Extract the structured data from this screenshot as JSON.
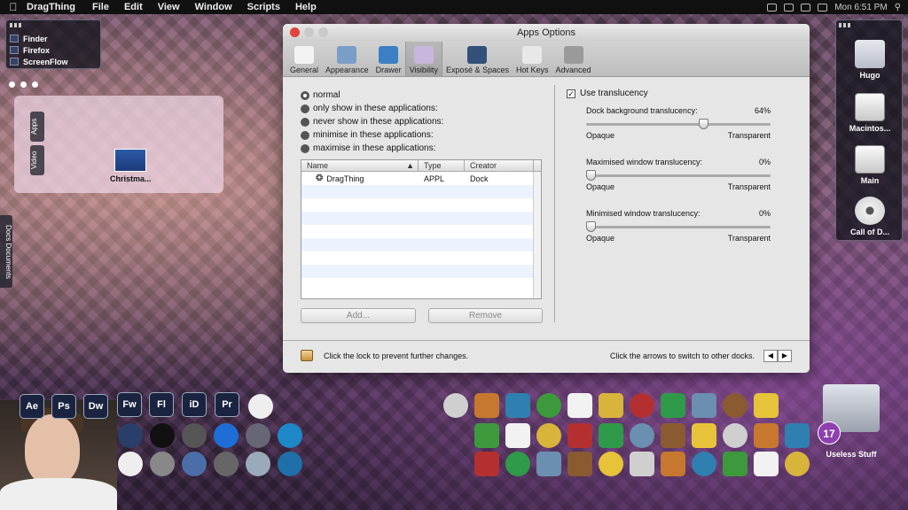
{
  "menubar": {
    "app_name": "DragThing",
    "items": [
      "File",
      "Edit",
      "View",
      "Window",
      "Scripts",
      "Help"
    ],
    "clock": "Mon 6:51 PM"
  },
  "left_dock": {
    "items": [
      {
        "label": "Finder"
      },
      {
        "label": "Firefox"
      },
      {
        "label": "ScreenFlow"
      }
    ]
  },
  "drawer": {
    "tabs": [
      "Apps",
      "Video"
    ],
    "item_label": "Christma..."
  },
  "side_tab": "Docs  Documents",
  "right_dock": {
    "items": [
      {
        "label": "Hugo",
        "icon": "folder-icon"
      },
      {
        "label": "Macintos...",
        "icon": "hard-disk-icon"
      },
      {
        "label": "Main",
        "icon": "hard-disk-icon"
      },
      {
        "label": "Call of D...",
        "icon": "cd-icon"
      }
    ]
  },
  "window": {
    "title": "Apps Options",
    "toolbar": [
      {
        "label": "General",
        "icon": "general-icon",
        "color": "#f3f3f3"
      },
      {
        "label": "Appearance",
        "icon": "appearance-icon",
        "color": "#7a9ec8"
      },
      {
        "label": "Drawer",
        "icon": "drawer-icon",
        "color": "#3b7fc4"
      },
      {
        "label": "Visibility",
        "icon": "visibility-icon",
        "color": "#c8b6dc",
        "selected": true
      },
      {
        "label": "Exposé & Spaces",
        "icon": "spaces-icon",
        "color": "#33507a"
      },
      {
        "label": "Hot Keys",
        "icon": "hotkeys-icon",
        "color": "#e8e8e8"
      },
      {
        "label": "Advanced",
        "icon": "advanced-icon",
        "color": "#9a9a9a"
      }
    ],
    "visibility_options": [
      {
        "label": "normal",
        "selected": true
      },
      {
        "label": "only show in these applications:",
        "selected": false
      },
      {
        "label": "never show in these applications:",
        "selected": false
      },
      {
        "label": "minimise in these applications:",
        "selected": false
      },
      {
        "label": "maximise in these applications:",
        "selected": false
      }
    ],
    "table": {
      "headers": [
        "Name",
        "Type",
        "Creator"
      ],
      "rows": [
        [
          "DragThing",
          "APPL",
          "Dock"
        ]
      ]
    },
    "add_button": "Add...",
    "remove_button": "Remove",
    "use_translucency": {
      "label": "Use translucency",
      "checked": true
    },
    "sliders": [
      {
        "label": "Dock background translucency:",
        "value_text": "64%",
        "fraction": 0.64,
        "min_label": "Opaque",
        "max_label": "Transparent"
      },
      {
        "label": "Maximised window translucency:",
        "value_text": "0%",
        "fraction": 0,
        "min_label": "Opaque",
        "max_label": "Transparent"
      },
      {
        "label": "Minimised window translucency:",
        "value_text": "0%",
        "fraction": 0,
        "min_label": "Opaque",
        "max_label": "Transparent"
      }
    ],
    "lock_text": "Click the lock to prevent further changes.",
    "arrows_text": "Click the arrows to switch to other docks.",
    "arrow_left": "◀",
    "arrow_right": "▶"
  },
  "bottom_dock": {
    "adobe": [
      "Ae",
      "Ps",
      "Dw",
      "Fw",
      "Fl",
      "iD",
      "Pr"
    ],
    "trash_label": "Useless Stuff",
    "trash_badge": "17"
  }
}
